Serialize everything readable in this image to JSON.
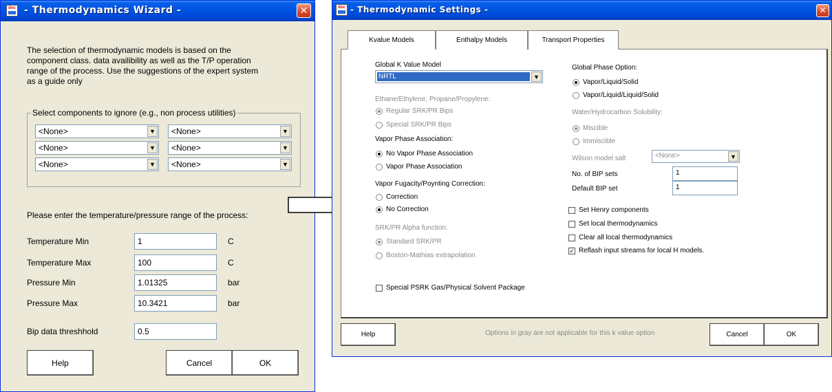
{
  "wizard": {
    "title": "- Thermodynamics Wizard -",
    "intro": [
      "The selection of thermodynamic models is based on the",
      "component class. data availibility as well as the T/P operation",
      "range of the process.  Use the suggestions of the expert system",
      "as a guide only"
    ],
    "ignore_group_label": "Select components to ignore (e.g., non process utilities)",
    "ignore_combos": [
      "<None>",
      "<None>",
      "<None>",
      "<None>",
      "<None>",
      "<None>"
    ],
    "range_prompt": "Please enter the temperature/pressure range of the process:",
    "rows": [
      {
        "label": "Temperature Min",
        "value": "1",
        "unit": "C"
      },
      {
        "label": "Temperature Max",
        "value": "100",
        "unit": "C"
      },
      {
        "label": "Pressure Min",
        "value": "1.01325",
        "unit": "bar"
      },
      {
        "label": "Pressure Max",
        "value": "10.3421",
        "unit": "bar"
      }
    ],
    "bip_label": "Bip data threshhold",
    "bip_value": "0.5",
    "help": "Help",
    "cancel": "Cancel",
    "ok": "OK"
  },
  "settings": {
    "title": "- Thermodynamic Settings -",
    "tabs": [
      "Kvalue Models",
      "Enthalpy Models",
      "Transport Properties"
    ],
    "global_k_label": "Global K Value Model",
    "global_k_value": "NRTL",
    "ethane_label": "Ethane/Ethylene, Propane/Propylene:",
    "ethane_opts": [
      "Regular SRK/PR Bips",
      "Special SRK/PR Bips"
    ],
    "vpa_label": "Vapor Phase Association:",
    "vpa_opts": [
      "No Vapor Phase Association",
      "Vapor Phase Association"
    ],
    "vf_label": "Vapor Fugacity/Poynting Correction:",
    "vf_opts": [
      "Correction",
      "No Correction"
    ],
    "alpha_label": "SRK/PR Alpha function:",
    "alpha_opts": [
      "Standard SRK/PR",
      "Boston-Mathias extrapolation"
    ],
    "psrk": "Special PSRK Gas/Physical Solvent Package",
    "gpo_label": "Global Phase Option:",
    "gpo_opts": [
      "Vapor/Liquid/Solid",
      "Vapor/Liquid/Liquid/Solid"
    ],
    "whs_label": "Water/Hydrocarbon Solubility:",
    "whs_opts": [
      "Miscible",
      "Immiscible"
    ],
    "wilson_label": "Wilson model salt",
    "wilson_value": "<None>",
    "bip_sets_label": "No. of BIP sets",
    "bip_sets_value": "1",
    "default_bip_label": "Default BIP set",
    "default_bip_value": "1",
    "checks": [
      "Set Henry components",
      "Set local thermodynamics",
      "Clear all local thermodynamics",
      "Reflash input streams for local H models."
    ],
    "footer_note": "Options in gray are not applicable for this k value option",
    "help": "Help",
    "cancel": "Cancel",
    "ok": "OK"
  },
  "colors": {
    "titlebar": "#0054e3",
    "dialog_bg": "#ece9d8",
    "close": "#d9462a",
    "selection": "#316ac5"
  }
}
